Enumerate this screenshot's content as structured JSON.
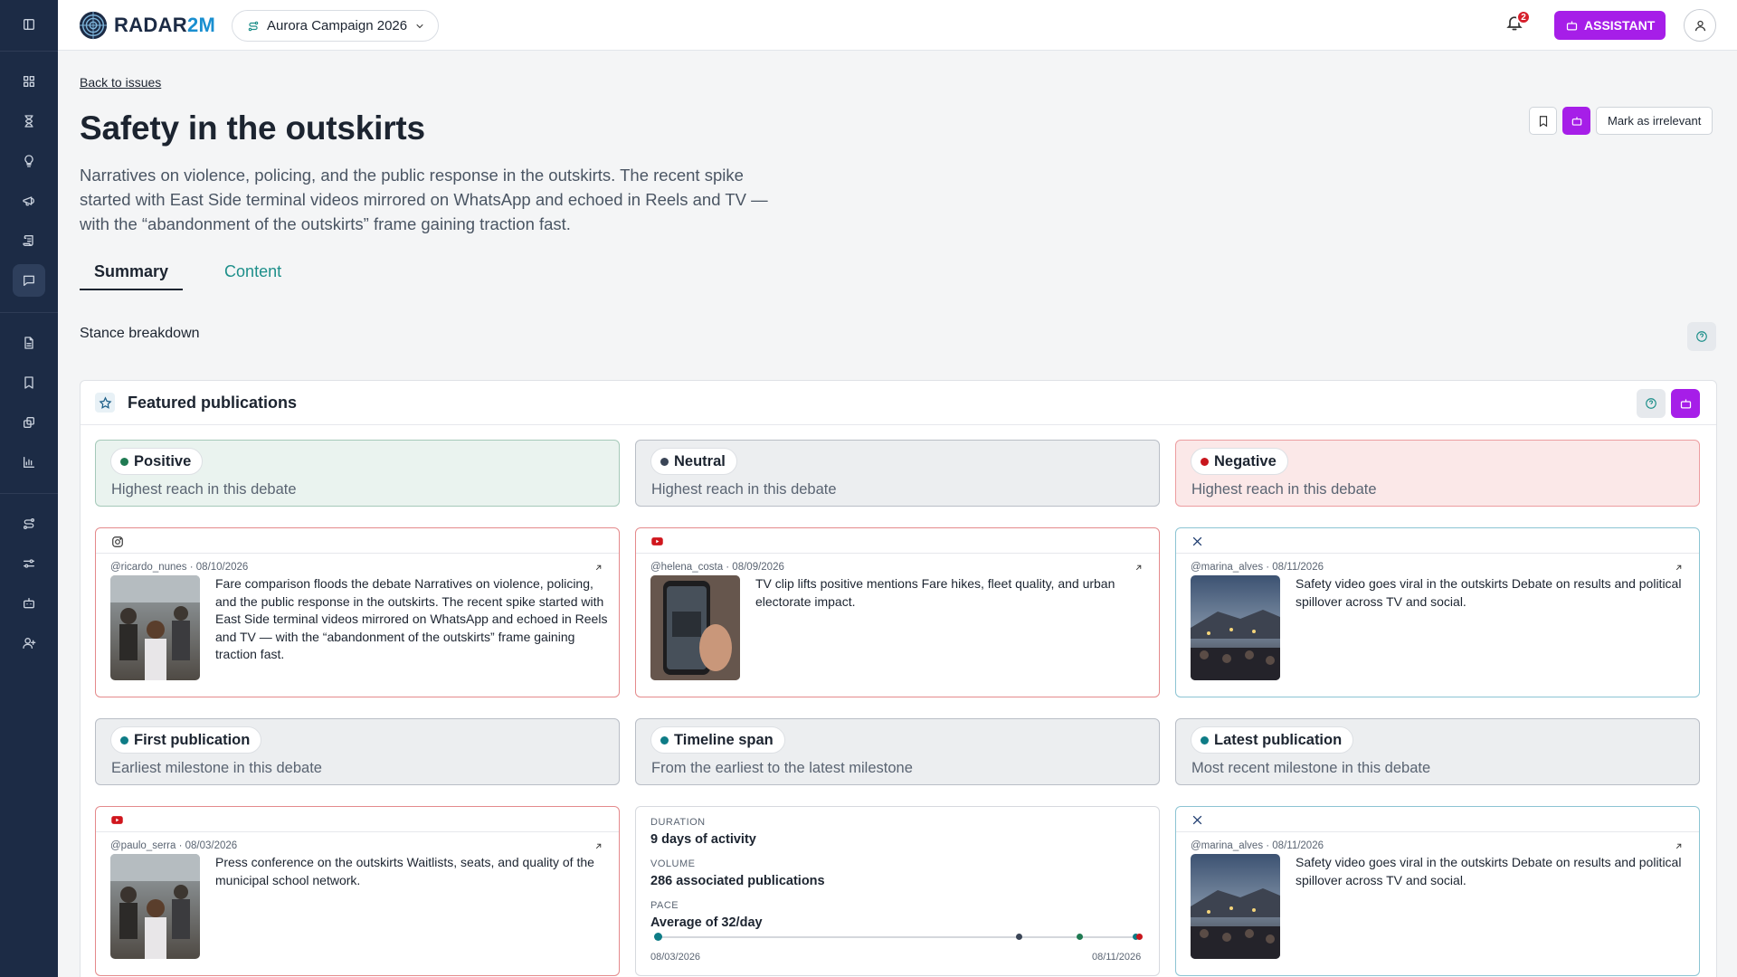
{
  "app": {
    "logo_main": "RADAR",
    "logo_accent": "2M"
  },
  "header": {
    "campaign": "Aurora Campaign 2026",
    "notifications_count": "2",
    "assistant_label": "ASSISTANT"
  },
  "page": {
    "back_link": "Back to issues",
    "title": "Safety in the outskirts",
    "description": "Narratives on violence, policing, and the public response in the outskirts. The recent spike started with East Side terminal videos mirrored on WhatsApp and echoed in Reels and TV — with the “abandonment of the outskirts” frame gaining traction fast.",
    "mark_irrelevant": "Mark as irrelevant",
    "tabs": [
      {
        "label": "Summary",
        "active": true
      },
      {
        "label": "Content",
        "active": false
      }
    ],
    "stance_breakdown": "Stance breakdown"
  },
  "featured": {
    "title": "Featured publications",
    "categories": [
      {
        "label": "Positive",
        "subtitle": "Highest reach in this debate",
        "color": "#1f7a52"
      },
      {
        "label": "Neutral",
        "subtitle": "Highest reach in this debate",
        "color": "#3a4556"
      },
      {
        "label": "Negative",
        "subtitle": "Highest reach in this debate",
        "color": "#c8161d"
      },
      {
        "label": "First publication",
        "subtitle": "Earliest milestone in this debate",
        "color": "#0e7c86"
      },
      {
        "label": "Timeline span",
        "subtitle": "From the earliest to the latest milestone",
        "color": "#0e7c86"
      },
      {
        "label": "Latest publication",
        "subtitle": "Most recent milestone in this debate",
        "color": "#0e7c86"
      }
    ],
    "publications": [
      {
        "platform": "instagram-icon",
        "meta": "@ricardo_nunes · 08/10/2026",
        "text": "Fare comparison floods the debate Narratives on violence, policing, and the public response in the outskirts. The recent spike started with East Side terminal videos mirrored on WhatsApp and echoed in Reels and TV — with the “abandonment of the outskirts” frame gaining traction fast."
      },
      {
        "platform": "youtube-icon",
        "meta": "@helena_costa · 08/09/2026",
        "text": "TV clip lifts positive mentions Fare hikes, fleet quality, and urban electorate impact."
      },
      {
        "platform": "x-icon",
        "meta": "@marina_alves · 08/11/2026",
        "text": "Safety video goes viral in the outskirts Debate on results and political spillover across TV and social."
      },
      {
        "platform": "youtube-icon",
        "meta": "@paulo_serra · 08/03/2026",
        "text": "Press conference on the outskirts Waitlists, seats, and quality of the municipal school network."
      },
      {
        "platform": "x-icon",
        "meta": "@marina_alves · 08/11/2026",
        "text": "Safety video goes viral in the outskirts Debate on results and political spillover across TV and social."
      }
    ],
    "timeline": {
      "duration_label": "DURATION",
      "duration_value": "9 days of activity",
      "volume_label": "VOLUME",
      "volume_value": "286 associated publications",
      "pace_label": "PACE",
      "pace_value": "Average of 32/day",
      "start_date": "08/03/2026",
      "end_date": "08/11/2026"
    }
  }
}
